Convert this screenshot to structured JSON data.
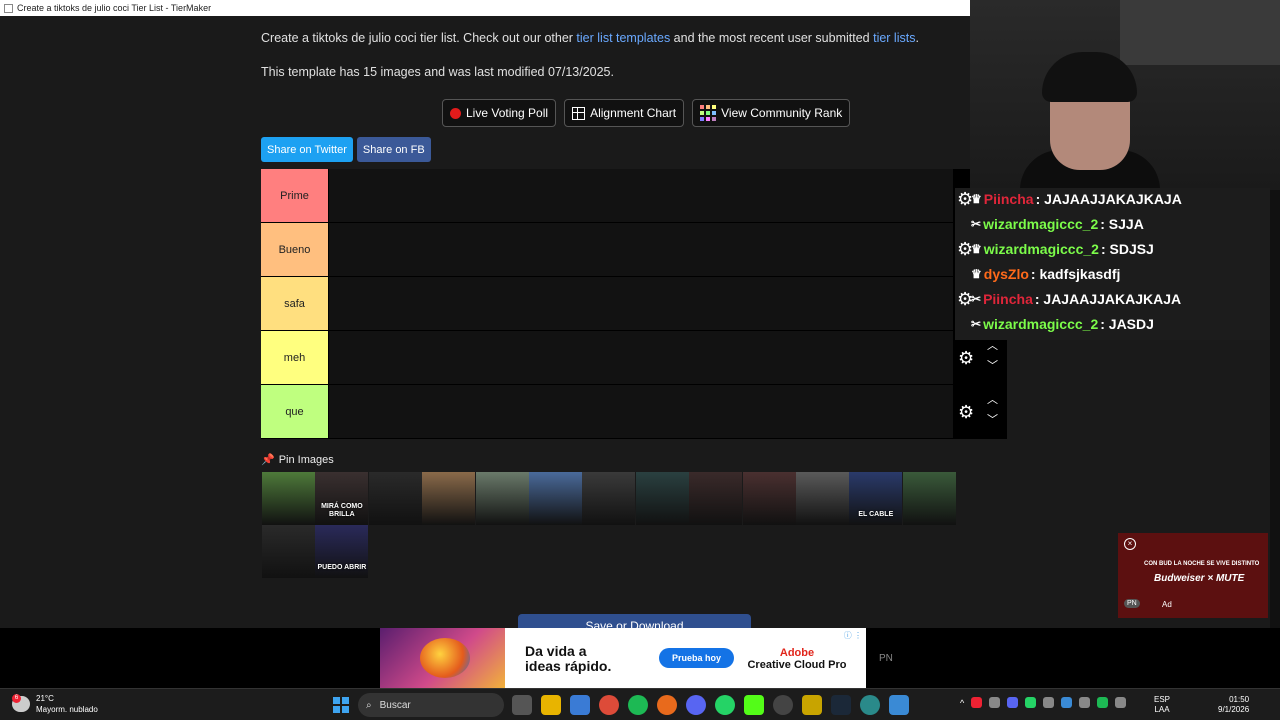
{
  "window": {
    "title": "Create a tiktoks de julio coci Tier List - TierMaker"
  },
  "intro": {
    "text1": "Create a tiktoks de julio coci tier list. Check out our other ",
    "link1": "tier list templates",
    "text2": " and the most recent user submitted ",
    "link2": "tier lists",
    "text3": "."
  },
  "meta": "This template has 15 images and was last modified 07/13/2025.",
  "buttons": {
    "live_poll": "Live Voting Poll",
    "alignment": "Alignment Chart",
    "community": "View Community Rank"
  },
  "share": {
    "twitter": "Share on Twitter",
    "fb": "Share on FB",
    "twitter_color": "#1da1f2",
    "fb_color": "#3b5998"
  },
  "tiers": [
    {
      "label": "Prime",
      "color": "#ff7f7f"
    },
    {
      "label": "Bueno",
      "color": "#ffbf7f"
    },
    {
      "label": "safa",
      "color": "#ffdf7f"
    },
    {
      "label": "meh",
      "color": "#ffff7f"
    },
    {
      "label": "que",
      "color": "#bfff7f"
    }
  ],
  "pin": {
    "label": "Pin Images",
    "icon": "pushpin-icon"
  },
  "images": [
    {
      "caption": "",
      "bg": "#4e7a3a"
    },
    {
      "caption": "MIRÁ COMO BRILLA",
      "bg": "#3a3030"
    },
    {
      "caption": "",
      "bg": "#2a2a2a"
    },
    {
      "caption": "",
      "bg": "#8a6a4a"
    },
    {
      "caption": "",
      "bg": "#6a7a6a"
    },
    {
      "caption": "",
      "bg": "#4a6a9a"
    },
    {
      "caption": "",
      "bg": "#3a3a3a"
    },
    {
      "caption": "",
      "bg": "#2a4040"
    },
    {
      "caption": "",
      "bg": "#3a2a2a"
    },
    {
      "caption": "",
      "bg": "#4a3030"
    },
    {
      "caption": "",
      "bg": "#5a5a5a"
    },
    {
      "caption": "EL CABLE",
      "bg": "#2a3a6a"
    },
    {
      "caption": "",
      "bg": "#3a5a3a"
    },
    {
      "caption": "",
      "bg": "#2a2a2a"
    },
    {
      "caption": "PUEDO ABRIR",
      "bg": "#2a2a5a"
    }
  ],
  "save_button": "Save or Download",
  "chat": [
    {
      "user": "Piincha",
      "text": ": JAJAAJJAKAJKAJA",
      "color": "#e0263a"
    },
    {
      "user": "wizardmagiccc_2",
      "text": ": SJJA",
      "color": "#7cfc4a"
    },
    {
      "user": "wizardmagiccc_2",
      "text": ": SDJSJ",
      "color": "#7cfc4a"
    },
    {
      "user": "dysZlo",
      "text": ": kadfsjkasdfj",
      "color": "#ff6a1a"
    },
    {
      "user": "Piincha",
      "text": ": JAJAAJJAKAJKAJA",
      "color": "#e0263a"
    },
    {
      "user": "wizardmagiccc_2",
      "text": ": JASDJ",
      "color": "#7cfc4a"
    }
  ],
  "overlay_tag": "PN",
  "side_ad": {
    "line1": "CON BUD LA NOCHE SE VIVE DISTINTO",
    "line2": "Budweiser × MUTE",
    "ad": "Ad",
    "pn": "PN"
  },
  "banner": {
    "headline1": "Da vida a",
    "headline2": "ideas rápido.",
    "cta": "Prueba hoy",
    "brand1": "Adobe",
    "brand2": "Creative Cloud Pro"
  },
  "taskbar": {
    "temp": "21°C",
    "weather": "Mayorm. nublado",
    "badge": "6",
    "search": "Buscar",
    "lang1": "ESP",
    "lang2": "LAA",
    "time": "01:50",
    "date": "9/1/2026"
  }
}
